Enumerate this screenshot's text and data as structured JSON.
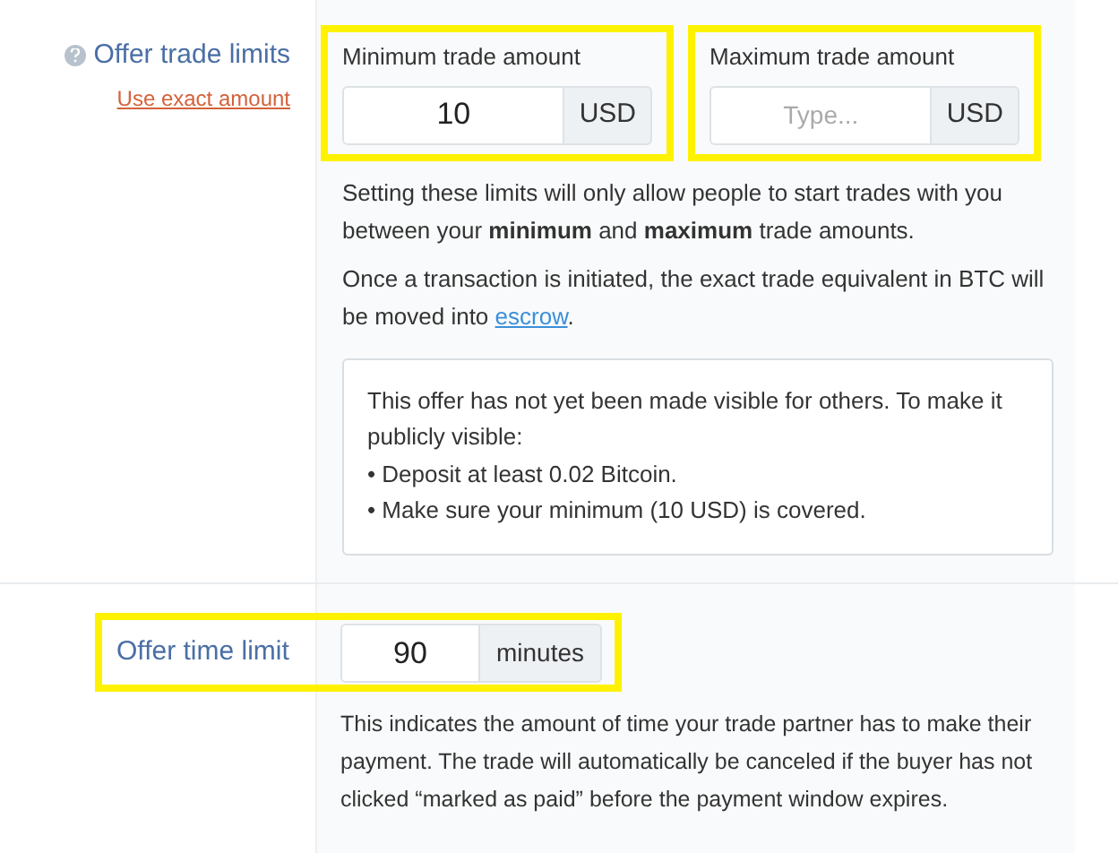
{
  "trade_limits": {
    "title": "Offer trade limits",
    "link": "Use exact amount",
    "fields": [
      {
        "label": "Minimum trade amount",
        "value": "10",
        "addon": "USD",
        "highlighted": true
      },
      {
        "label": "Maximum trade amount",
        "placeholder": "Type...",
        "addon": "USD",
        "highlighted": true
      }
    ],
    "help": "Setting these limits will only allow people to start trades with you between your **minimum** and **maximum** trade amounts.",
    "escrow_text": "Once a transaction is initiated, the exact trade equivalent in BTC will be moved into",
    "escrow_link": "escrow",
    "escrow_end": ".",
    "notice": {
      "text": "This offer has not yet been made visible for others. To make it publicly visible:",
      "items": [
        "• Deposit at least 0.02 Bitcoin.",
        "• Make sure your minimum (10 USD) is covered."
      ]
    }
  },
  "time_limit": {
    "title": "Offer time limit",
    "value": "90",
    "addon": "minutes",
    "highlighted": true,
    "help": "This indicates the amount of time your trade partner has to make their payment. The trade will automatically be canceled if the buyer has not clicked “marked as paid” before the payment window expires."
  }
}
